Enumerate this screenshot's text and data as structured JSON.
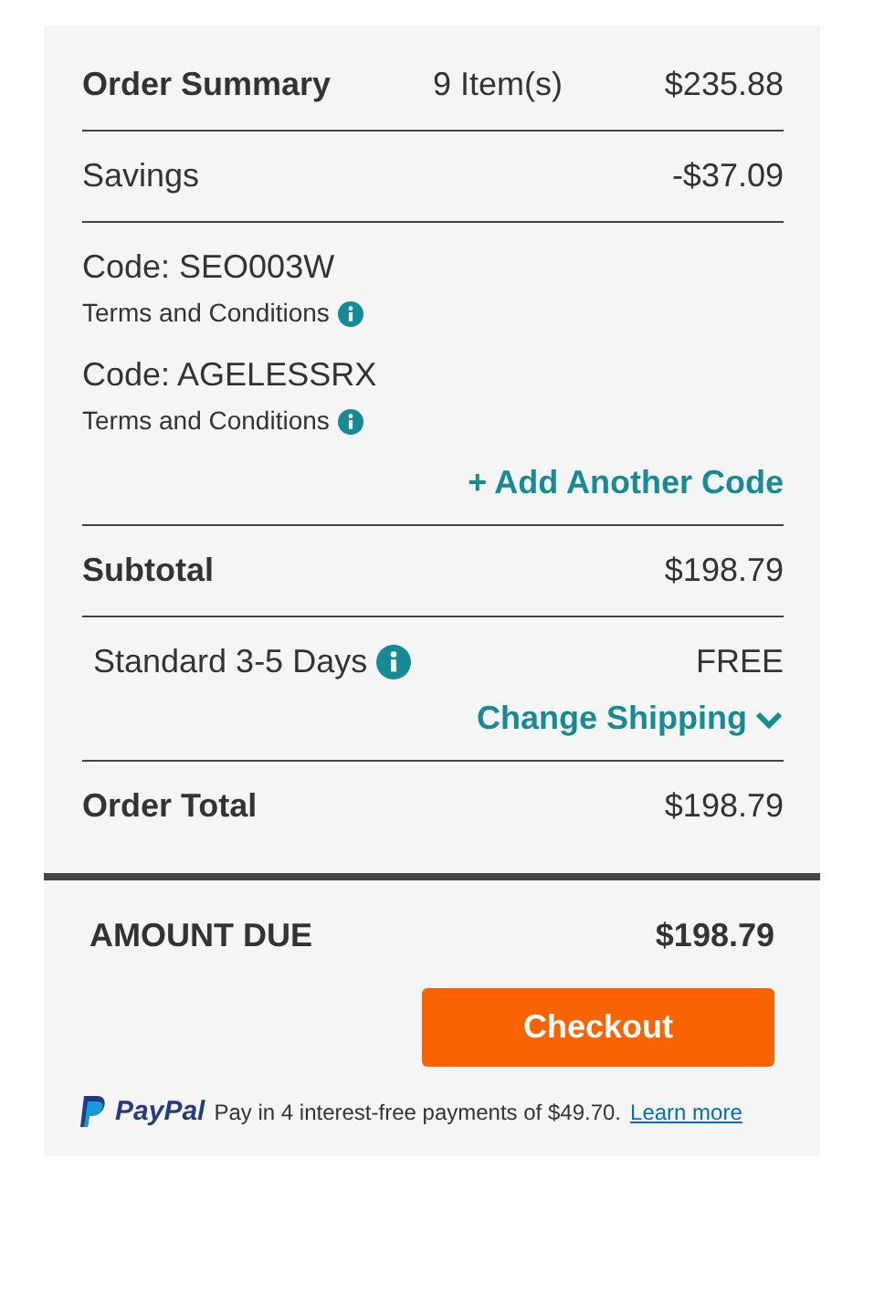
{
  "summary": {
    "title": "Order Summary",
    "items": "9 Item(s)",
    "amount": "$235.88"
  },
  "savings": {
    "label": "Savings",
    "amount": "-$37.09"
  },
  "codes": [
    {
      "code": "Code: SEO003W",
      "terms": "Terms and Conditions"
    },
    {
      "code": "Code: AGELESSRX",
      "terms": "Terms and Conditions"
    }
  ],
  "add_code": {
    "icon": "+",
    "label": "Add Another Code"
  },
  "subtotal": {
    "label": "Subtotal",
    "amount": "$198.79"
  },
  "shipping": {
    "method": "Standard 3-5 Days",
    "price": "FREE",
    "change": "Change Shipping"
  },
  "order_total": {
    "label": "Order Total",
    "amount": "$198.79"
  },
  "amount_due": {
    "label": "AMOUNT DUE",
    "amount": "$198.79"
  },
  "checkout": "Checkout",
  "paypal": {
    "brand": "PayPal",
    "text": "Pay in 4 interest-free payments of $49.70.",
    "link": "Learn more"
  }
}
